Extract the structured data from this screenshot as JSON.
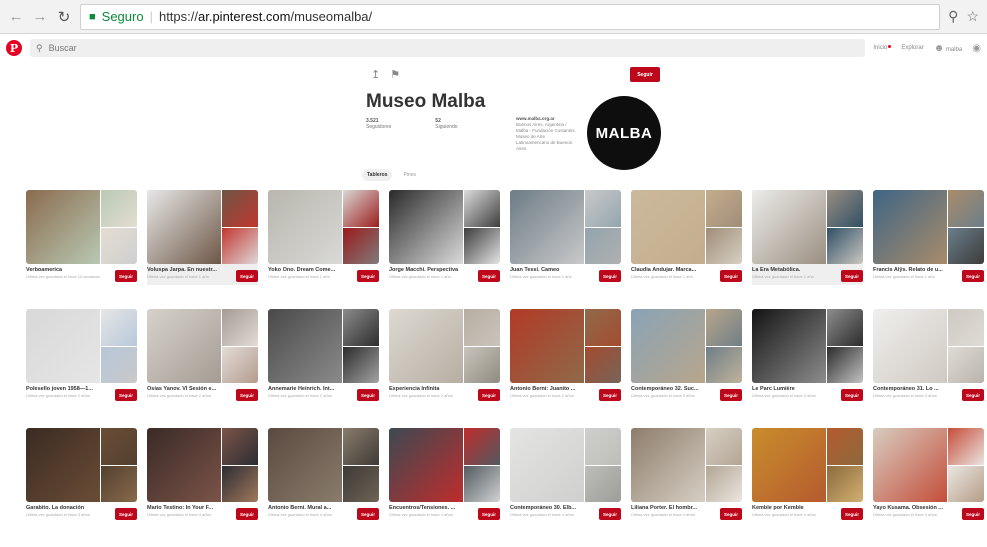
{
  "browser": {
    "secure_label": "Seguro",
    "url_prefix": "https://",
    "url_host": "ar.pinterest.com",
    "url_path": "/museomalba/"
  },
  "header": {
    "search_placeholder": "Buscar",
    "links": [
      "Inicio",
      "Explorar",
      "malba"
    ]
  },
  "profile": {
    "follow_label": "Seguir",
    "name": "Museo Malba",
    "followers_count": "3.521",
    "followers_label": "Seguidores",
    "following_count": "52",
    "following_label": "Siguiendo",
    "website": "www.malba.org.ar",
    "bio": "Buenos Aires, Argentina / Malba - Fundación Costantini, Museo de Arte Latinoamericano de Buenos Aires.",
    "avatar_text": "MALBA",
    "tabs": [
      "Tableros",
      "Pines"
    ]
  },
  "board_follow_label": "Seguir",
  "boards": [
    {
      "title": "Verboamerica",
      "subtitle": "Última vez guardado el hace 10 semanas",
      "colors": [
        "#8a6b4e",
        "#b9c9b4",
        "#e4ddd2",
        "#cfcfcf"
      ]
    },
    {
      "title": "Voluspa Jarpa. En nuestr...",
      "subtitle": "Última vez guardado el hace 1 año",
      "colors": [
        "#e8e8e8",
        "#6d5645",
        "#c2362f",
        "#dedede"
      ]
    },
    {
      "title": "Yoko Ono. Dream Come...",
      "subtitle": "Última vez guardado el hace 1 año",
      "colors": [
        "#b8b6ae",
        "#d9d9d6",
        "#9b1b1b",
        "#7e7e7e"
      ]
    },
    {
      "title": "Jorge Macchi. Perspectiva",
      "subtitle": "Última vez guardado el hace 1 año",
      "colors": [
        "#2a2a2a",
        "#dcdcdc",
        "#3c3c3c",
        "#e9e9e9"
      ]
    },
    {
      "title": "Juan Tessi. Cameo",
      "subtitle": "Última vez guardado el hace 1 año",
      "colors": [
        "#6d7c86",
        "#c9c9c9",
        "#93a5ae",
        "#b0b0b0"
      ]
    },
    {
      "title": "Claudia Andujar. Marca...",
      "subtitle": "Última vez guardado el hace 1 año",
      "colors": [
        "#cbb99c",
        "#c4ad8e",
        "#9f8d78",
        "#d9d2c5"
      ]
    },
    {
      "title": "La Era Metabólica.",
      "subtitle": "Última vez guardado el hace 1 año",
      "colors": [
        "#ececea",
        "#9a8e80",
        "#2f4f66",
        "#cfcbc3"
      ]
    },
    {
      "title": "Francis Alÿs. Relato de u...",
      "subtitle": "Última vez guardado el hace 1 año",
      "colors": [
        "#3e6585",
        "#a98c6a",
        "#6b7e8a",
        "#3a3a3a"
      ]
    },
    {
      "title": "Polesello joven 1958—1...",
      "subtitle": "Última vez guardado el hace 2 años",
      "colors": [
        "#d8d8d8",
        "#e6e6e6",
        "#b7c7d9",
        "#c9c9c9"
      ]
    },
    {
      "title": "Osías Yanov. VI Sesión e...",
      "subtitle": "Última vez guardado el hace 2 años",
      "colors": [
        "#d6d2cb",
        "#a49c93",
        "#e2dcd7",
        "#b39a8c"
      ]
    },
    {
      "title": "Annemarie Heinrich. Int...",
      "subtitle": "Última vez guardado el hace 2 años",
      "colors": [
        "#4a4a4a",
        "#8b8b8b",
        "#2c2c2c",
        "#a7a7a7"
      ]
    },
    {
      "title": "Experiencia Infinita",
      "subtitle": "Última vez guardado el hace 2 años",
      "colors": [
        "#dcd9d2",
        "#b7aea2",
        "#c9c4bb",
        "#8f8a80"
      ]
    },
    {
      "title": "Antonio Berni: Juanito ...",
      "subtitle": "Última vez guardado el hace 2 años",
      "colors": [
        "#b23a26",
        "#8f6a4a",
        "#a44b2f",
        "#76655a"
      ]
    },
    {
      "title": "Contemporáneo 32. Suc...",
      "subtitle": "Última vez guardado el hace 3 años",
      "colors": [
        "#8aa3b6",
        "#b8a68c",
        "#6f7e86",
        "#c2b49d"
      ]
    },
    {
      "title": "Le Parc Lumière",
      "subtitle": "Última vez guardado el hace 3 años",
      "colors": [
        "#141414",
        "#8d8d8d",
        "#2b2b2b",
        "#c7c7c7"
      ]
    },
    {
      "title": "Contemporáneo 31. Lo ...",
      "subtitle": "Última vez guardado el hace 3 años",
      "colors": [
        "#f0efed",
        "#cfc9c2",
        "#dedbd6",
        "#b9b2aa"
      ]
    },
    {
      "title": "Garabito. La donación",
      "subtitle": "Última vez guardado el hace 3 años",
      "colors": [
        "#3a2b22",
        "#6b4d36",
        "#52402f",
        "#8b6b4c"
      ]
    },
    {
      "title": "Mario Testino: In Your F...",
      "subtitle": "Última vez guardado el hace 4 años",
      "colors": [
        "#3b2a27",
        "#7b5448",
        "#2c2c33",
        "#a57b5d"
      ]
    },
    {
      "title": "Antonio Berni. Mural a...",
      "subtitle": "Última vez guardado el hace 4 años",
      "colors": [
        "#5a4a40",
        "#8a7c6c",
        "#3d3a36",
        "#6f6457"
      ]
    },
    {
      "title": "Encuentros/Tensiones. ...",
      "subtitle": "Última vez guardado el hace 4 años",
      "colors": [
        "#3c4a52",
        "#c02c2c",
        "#505a60",
        "#d6d6d6"
      ]
    },
    {
      "title": "Contemporáneo 30. Elb...",
      "subtitle": "Última vez guardado el hace 4 años",
      "colors": [
        "#e4e4e2",
        "#cfcfcd",
        "#bdbdb9",
        "#9c9c98"
      ]
    },
    {
      "title": "Liliana Porter. El hombr...",
      "subtitle": "Última vez guardado el hace 4 años",
      "colors": [
        "#8d7d6b",
        "#d7cfc4",
        "#b3a594",
        "#ece8e2"
      ]
    },
    {
      "title": "Kemble por Kemble",
      "subtitle": "Última vez guardado el hace 4 años",
      "colors": [
        "#c98d2c",
        "#b55a2f",
        "#8c6a3c",
        "#d4b273"
      ]
    },
    {
      "title": "Yayo Kusama. Obsesión ...",
      "subtitle": "Última vez guardado el hace 4 años",
      "colors": [
        "#d7ccbf",
        "#c54d3a",
        "#eae6e1",
        "#b49b85"
      ]
    }
  ]
}
